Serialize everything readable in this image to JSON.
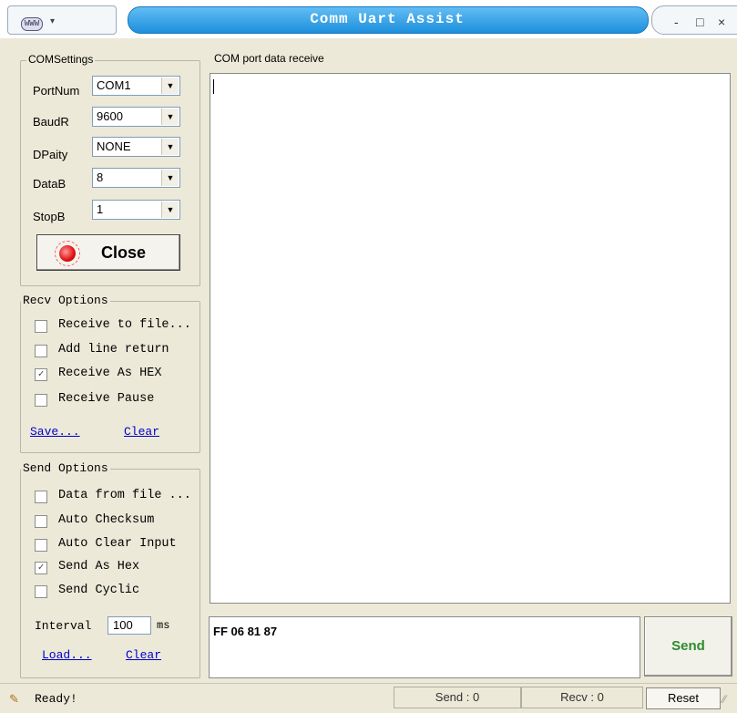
{
  "window": {
    "title": "Comm Uart Assist",
    "sysmenu_icon": "WWW",
    "sysmenu_arrow": "▾",
    "minimize": "-",
    "maximize": "□",
    "close": "×"
  },
  "com_settings": {
    "title": "COMSettings",
    "port_label": "PortNum",
    "port_value": "COM1",
    "baud_label": "BaudR",
    "baud_value": "9600",
    "parity_label": "DPaity",
    "parity_value": "NONE",
    "data_label": "DataB",
    "data_value": "8",
    "stop_label": "StopB",
    "stop_value": "1",
    "close_button": "Close"
  },
  "recv_options": {
    "title": "Recv Options",
    "items": [
      {
        "label": "Receive to file...",
        "checked": false
      },
      {
        "label": "Add line return",
        "checked": false
      },
      {
        "label": "Receive As HEX",
        "checked": true
      },
      {
        "label": "Receive Pause",
        "checked": false
      }
    ],
    "save_link": "Save...",
    "clear_link": "Clear"
  },
  "send_options": {
    "title": "Send Options",
    "items": [
      {
        "label": "Data from file ...",
        "checked": false
      },
      {
        "label": "Auto Checksum",
        "checked": false
      },
      {
        "label": "Auto Clear Input",
        "checked": false
      },
      {
        "label": "Send As Hex",
        "checked": true
      },
      {
        "label": "Send Cyclic",
        "checked": false
      }
    ],
    "interval_label": "Interval",
    "interval_value": "100",
    "interval_unit": "ms",
    "load_link": "Load...",
    "clear_link": "Clear"
  },
  "receive": {
    "title": "COM port data receive",
    "content": ""
  },
  "send": {
    "input_value": "FF 06 81 87",
    "button": "Send"
  },
  "statusbar": {
    "status": "Ready!",
    "send_count": "Send : 0",
    "recv_count": "Recv : 0",
    "reset": "Reset"
  },
  "colors": {
    "title_bar": "#1c8fdc",
    "send_button_text": "#2e8b2e",
    "link": "#0000cc",
    "led": "#e01010"
  },
  "icons": [
    "globe-icon",
    "chevron-down-icon",
    "minimize-icon",
    "maximize-icon",
    "close-icon",
    "led-icon",
    "status-icon"
  ]
}
